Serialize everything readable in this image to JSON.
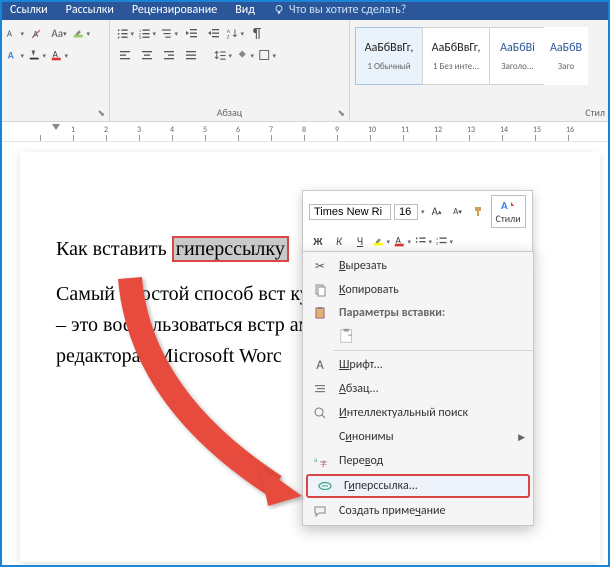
{
  "tabs": {
    "items": [
      "Ссылки",
      "Рассылки",
      "Рецензирование",
      "Вид"
    ],
    "tell_me": "Что вы хотите сделать?"
  },
  "ribbon": {
    "paragraph_label": "Абзац",
    "styles_label": "Стил",
    "styles": [
      {
        "name": "АаБбВвГг,",
        "desc": "1 Обычный"
      },
      {
        "name": "АаБбВвГг,",
        "desc": "1 Без инте..."
      },
      {
        "name": "АаБбВі",
        "desc": "Заголо..."
      },
      {
        "name": "АаБбВ",
        "desc": "Заго"
      }
    ]
  },
  "document": {
    "line1_before": "Как вставить ",
    "line1_selected": "гиперссылку",
    "line2": "Самый простой способ вст                                   кумент гипер",
    "line3": "– это воспользоваться встр                                   ами текстово",
    "line4": "редактора «Microsoft Worс"
  },
  "mini_toolbar": {
    "font": "Times New Ri",
    "size": "16",
    "styles_label": "Стили",
    "bold": "Ж",
    "italic": "К",
    "underline": "Ч",
    "grow": "A",
    "shrink": "A"
  },
  "context_menu": {
    "cut": "Вырезать",
    "copy": "Копировать",
    "paste_header": "Параметры вставки:",
    "font": "Шрифт...",
    "paragraph": "Абзац...",
    "smart_lookup": "Интеллектуальный поиск",
    "synonyms": "Синонимы",
    "translate": "Перевод",
    "hyperlink": "Гиперссылка...",
    "new_comment": "Создать примечание"
  }
}
